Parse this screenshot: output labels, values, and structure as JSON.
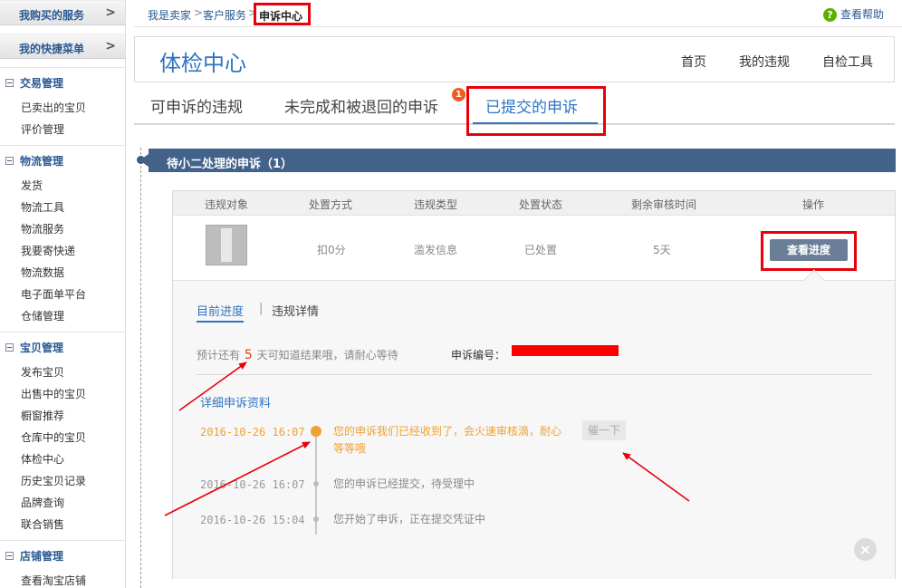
{
  "sidebar": {
    "top_buttons": [
      {
        "label": "我购买的服务",
        "arrow": ">"
      },
      {
        "label": "我的快捷菜单",
        "arrow": ">"
      }
    ],
    "sections": [
      {
        "title": "交易管理",
        "items": [
          "已卖出的宝贝",
          "评价管理"
        ]
      },
      {
        "title": "物流管理",
        "items": [
          "发货",
          "物流工具",
          "物流服务",
          "我要寄快递",
          "物流数据",
          "电子面单平台",
          "仓储管理"
        ]
      },
      {
        "title": "宝贝管理",
        "items": [
          "发布宝贝",
          "出售中的宝贝",
          "橱窗推荐",
          "仓库中的宝贝",
          "体检中心",
          "历史宝贝记录",
          "品牌查询",
          "联合销售"
        ]
      },
      {
        "title": "店铺管理",
        "items": [
          "查看淘宝店铺"
        ]
      }
    ]
  },
  "breadcrumb": {
    "items": [
      "我是卖家",
      "客户服务"
    ],
    "separator": ">",
    "current": "申诉中心",
    "help": "查看帮助"
  },
  "header": {
    "title": "体检中心",
    "nav": [
      "首页",
      "我的违规",
      "自检工具"
    ]
  },
  "tabs": {
    "items": [
      "可申诉的违规",
      "未完成和被退回的申诉",
      "已提交的申诉"
    ],
    "badge": "1"
  },
  "section": {
    "title": "待小二处理的申诉（1）"
  },
  "table": {
    "columns": [
      "违规对象",
      "处置方式",
      "违规类型",
      "处置状态",
      "剩余审核时间",
      "操作"
    ],
    "row": {
      "penalty": "扣0分",
      "type": "滥发信息",
      "status": "已处置",
      "remaining": "5天",
      "action": "查看进度"
    }
  },
  "detail": {
    "subtabs": [
      "目前进度",
      "违规详情"
    ],
    "subtab_sep": "|",
    "estimate_pre": "预计还有",
    "estimate_days": "5",
    "estimate_post": "天可知道结果哦，请耐心等待",
    "appeal_no_label": "申诉编号：",
    "section_title": "详细申诉资料",
    "urge": "催一下",
    "close": "×",
    "timeline": [
      {
        "time": "2016-10-26 16:07",
        "text": "您的申诉我们已经收到了，会火速审核滴，耐心等等哦"
      },
      {
        "time": "2016-10-26 16:07",
        "text": "您的申诉已经提交，待受理中"
      },
      {
        "time": "2016-10-26 15:04",
        "text": "您开始了申诉，正在提交凭证中"
      }
    ]
  },
  "colors": {
    "accent": "#2e74c2",
    "section_bar": "#43628a",
    "highlight": "#e8000b",
    "timeline_current": "#f0a131"
  }
}
